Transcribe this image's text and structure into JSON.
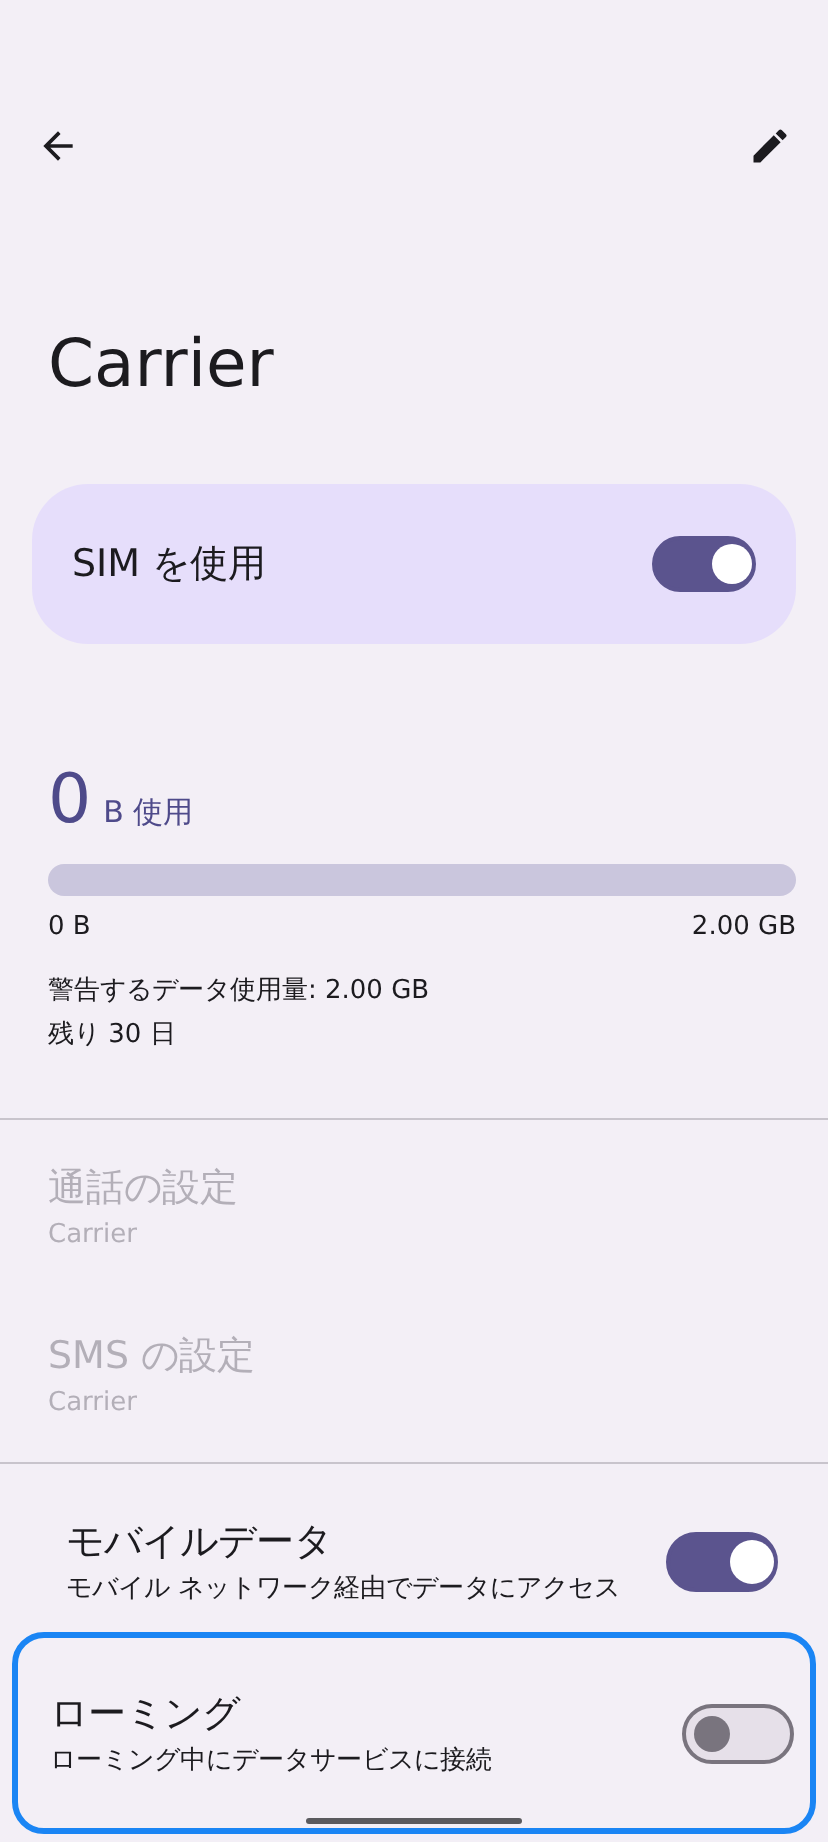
{
  "top_bar": {
    "back": true,
    "edit": true
  },
  "title": "Carrier",
  "sim_card": {
    "label": "SIM を使用",
    "on": true
  },
  "usage": {
    "amount": "0",
    "unit": "B 使用",
    "level": 0,
    "min_label": "0 B",
    "max_label": "2.00 GB",
    "warning": "警告するデータ使用量: 2.00 GB",
    "remaining": "残り 30 日"
  },
  "settings": [
    {
      "title": "通話の設定",
      "subtitle": "Carrier",
      "disabled": true
    },
    {
      "title": "SMS の設定",
      "subtitle": "Carrier",
      "disabled": true
    }
  ],
  "toggles": [
    {
      "title": "モバイルデータ",
      "subtitle": "モバイル ネットワーク経由でデータにアクセス",
      "on": true,
      "focused": false
    },
    {
      "title": "ローミング",
      "subtitle": "ローミング中にデータサービスに接続",
      "on": false,
      "focused": true
    }
  ]
}
